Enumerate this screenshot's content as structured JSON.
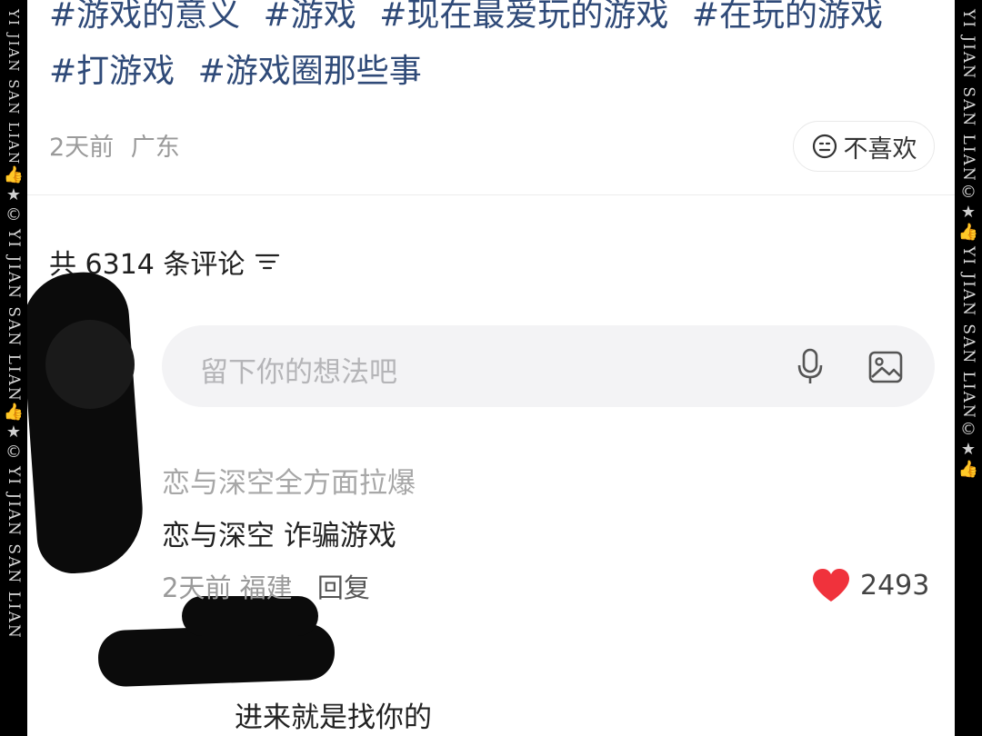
{
  "watermark": {
    "text": "YI JIAN SAN LIAN",
    "glyphs": [
      "👍",
      "★",
      "©"
    ]
  },
  "post": {
    "tags": [
      "#游戏的意义",
      "#游戏",
      "#现在最爱玩的游戏",
      "#在玩的游戏",
      "#打游戏",
      "#游戏圈那些事"
    ],
    "time": "2天前",
    "location": "广东",
    "dislike_label": "不喜欢"
  },
  "comments_header": {
    "label": "共 6314 条评论"
  },
  "input": {
    "placeholder": "留下你的想法吧"
  },
  "comments": [
    {
      "user": "恋与深空全方面拉爆",
      "text": "恋与深空 诈骗游戏",
      "time": "2天前",
      "location": "福建",
      "reply_label": "回复",
      "likes": "2493"
    }
  ],
  "reply": {
    "text": "进来就是找你的"
  },
  "colors": {
    "tag": "#2f4a78",
    "heart": "#f0323c",
    "input_bg": "#f3f3f5"
  }
}
